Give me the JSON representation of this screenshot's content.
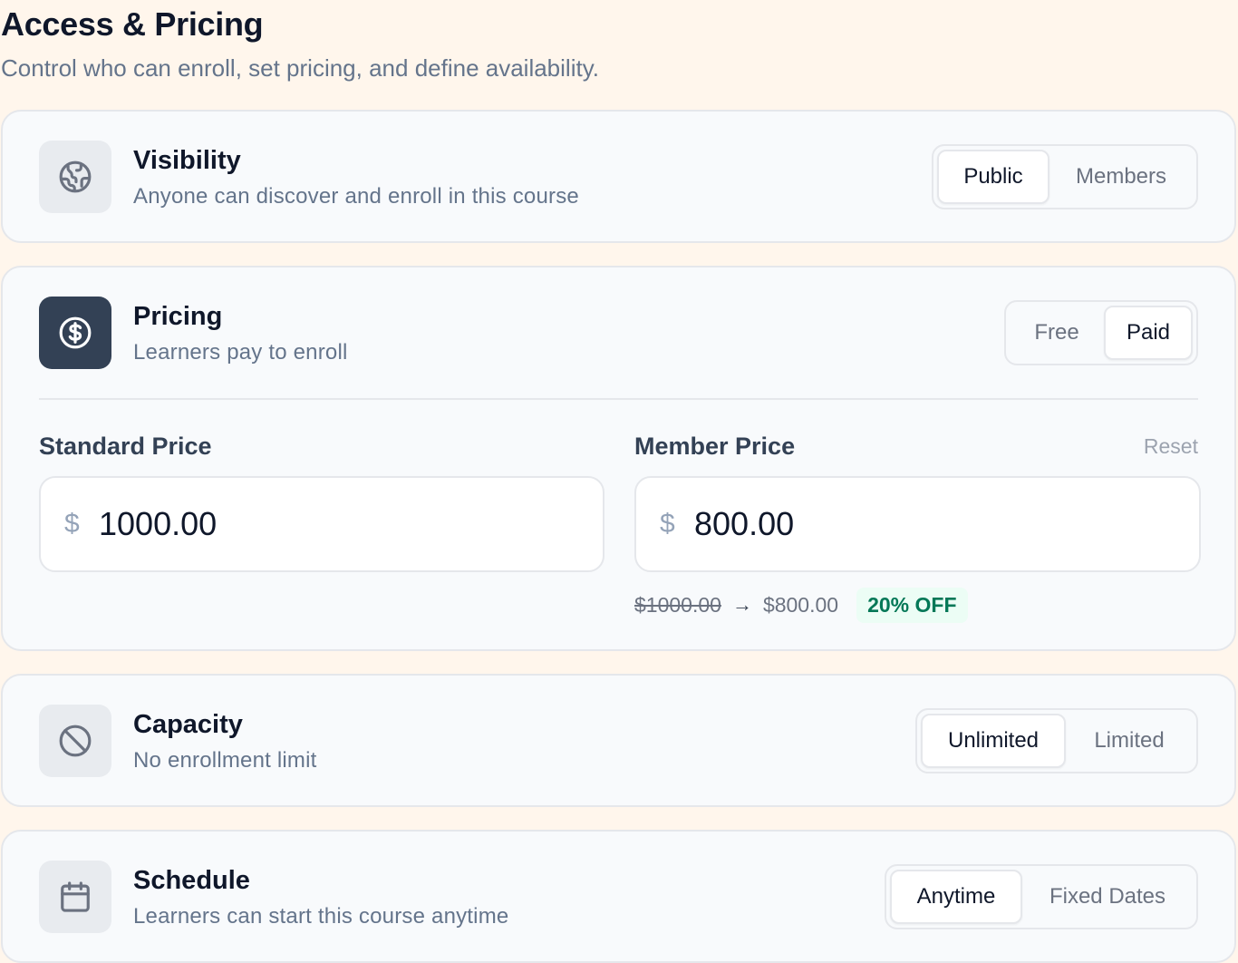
{
  "header": {
    "title": "Access & Pricing",
    "subtitle": "Control who can enroll, set pricing, and define availability."
  },
  "visibility": {
    "icon": "globe-icon",
    "title": "Visibility",
    "description": "Anyone can discover and enroll in this course",
    "options": [
      "Public",
      "Members"
    ],
    "selected": "Public"
  },
  "pricing": {
    "icon": "dollar-circle-icon",
    "title": "Pricing",
    "description": "Learners pay to enroll",
    "options": [
      "Free",
      "Paid"
    ],
    "selected": "Paid",
    "standard": {
      "label": "Standard Price",
      "currency": "$",
      "value": "1000.00"
    },
    "member": {
      "label": "Member Price",
      "reset_label": "Reset",
      "currency": "$",
      "value": "800.00"
    },
    "discount": {
      "old_price": "$1000.00",
      "arrow": "→",
      "new_price": "$800.00",
      "badge": "20% OFF"
    }
  },
  "capacity": {
    "icon": "ban-icon",
    "title": "Capacity",
    "description": "No enrollment limit",
    "options": [
      "Unlimited",
      "Limited"
    ],
    "selected": "Unlimited"
  },
  "schedule": {
    "icon": "calendar-icon",
    "title": "Schedule",
    "description": "Learners can start this course anytime",
    "options": [
      "Anytime",
      "Fixed Dates"
    ],
    "selected": "Anytime"
  },
  "colors": {
    "page_background": "#fff6ec",
    "card_background": "#f8fafc",
    "dark_icon_background": "#334155",
    "badge_background": "#ecfdf5",
    "badge_text": "#047857"
  }
}
